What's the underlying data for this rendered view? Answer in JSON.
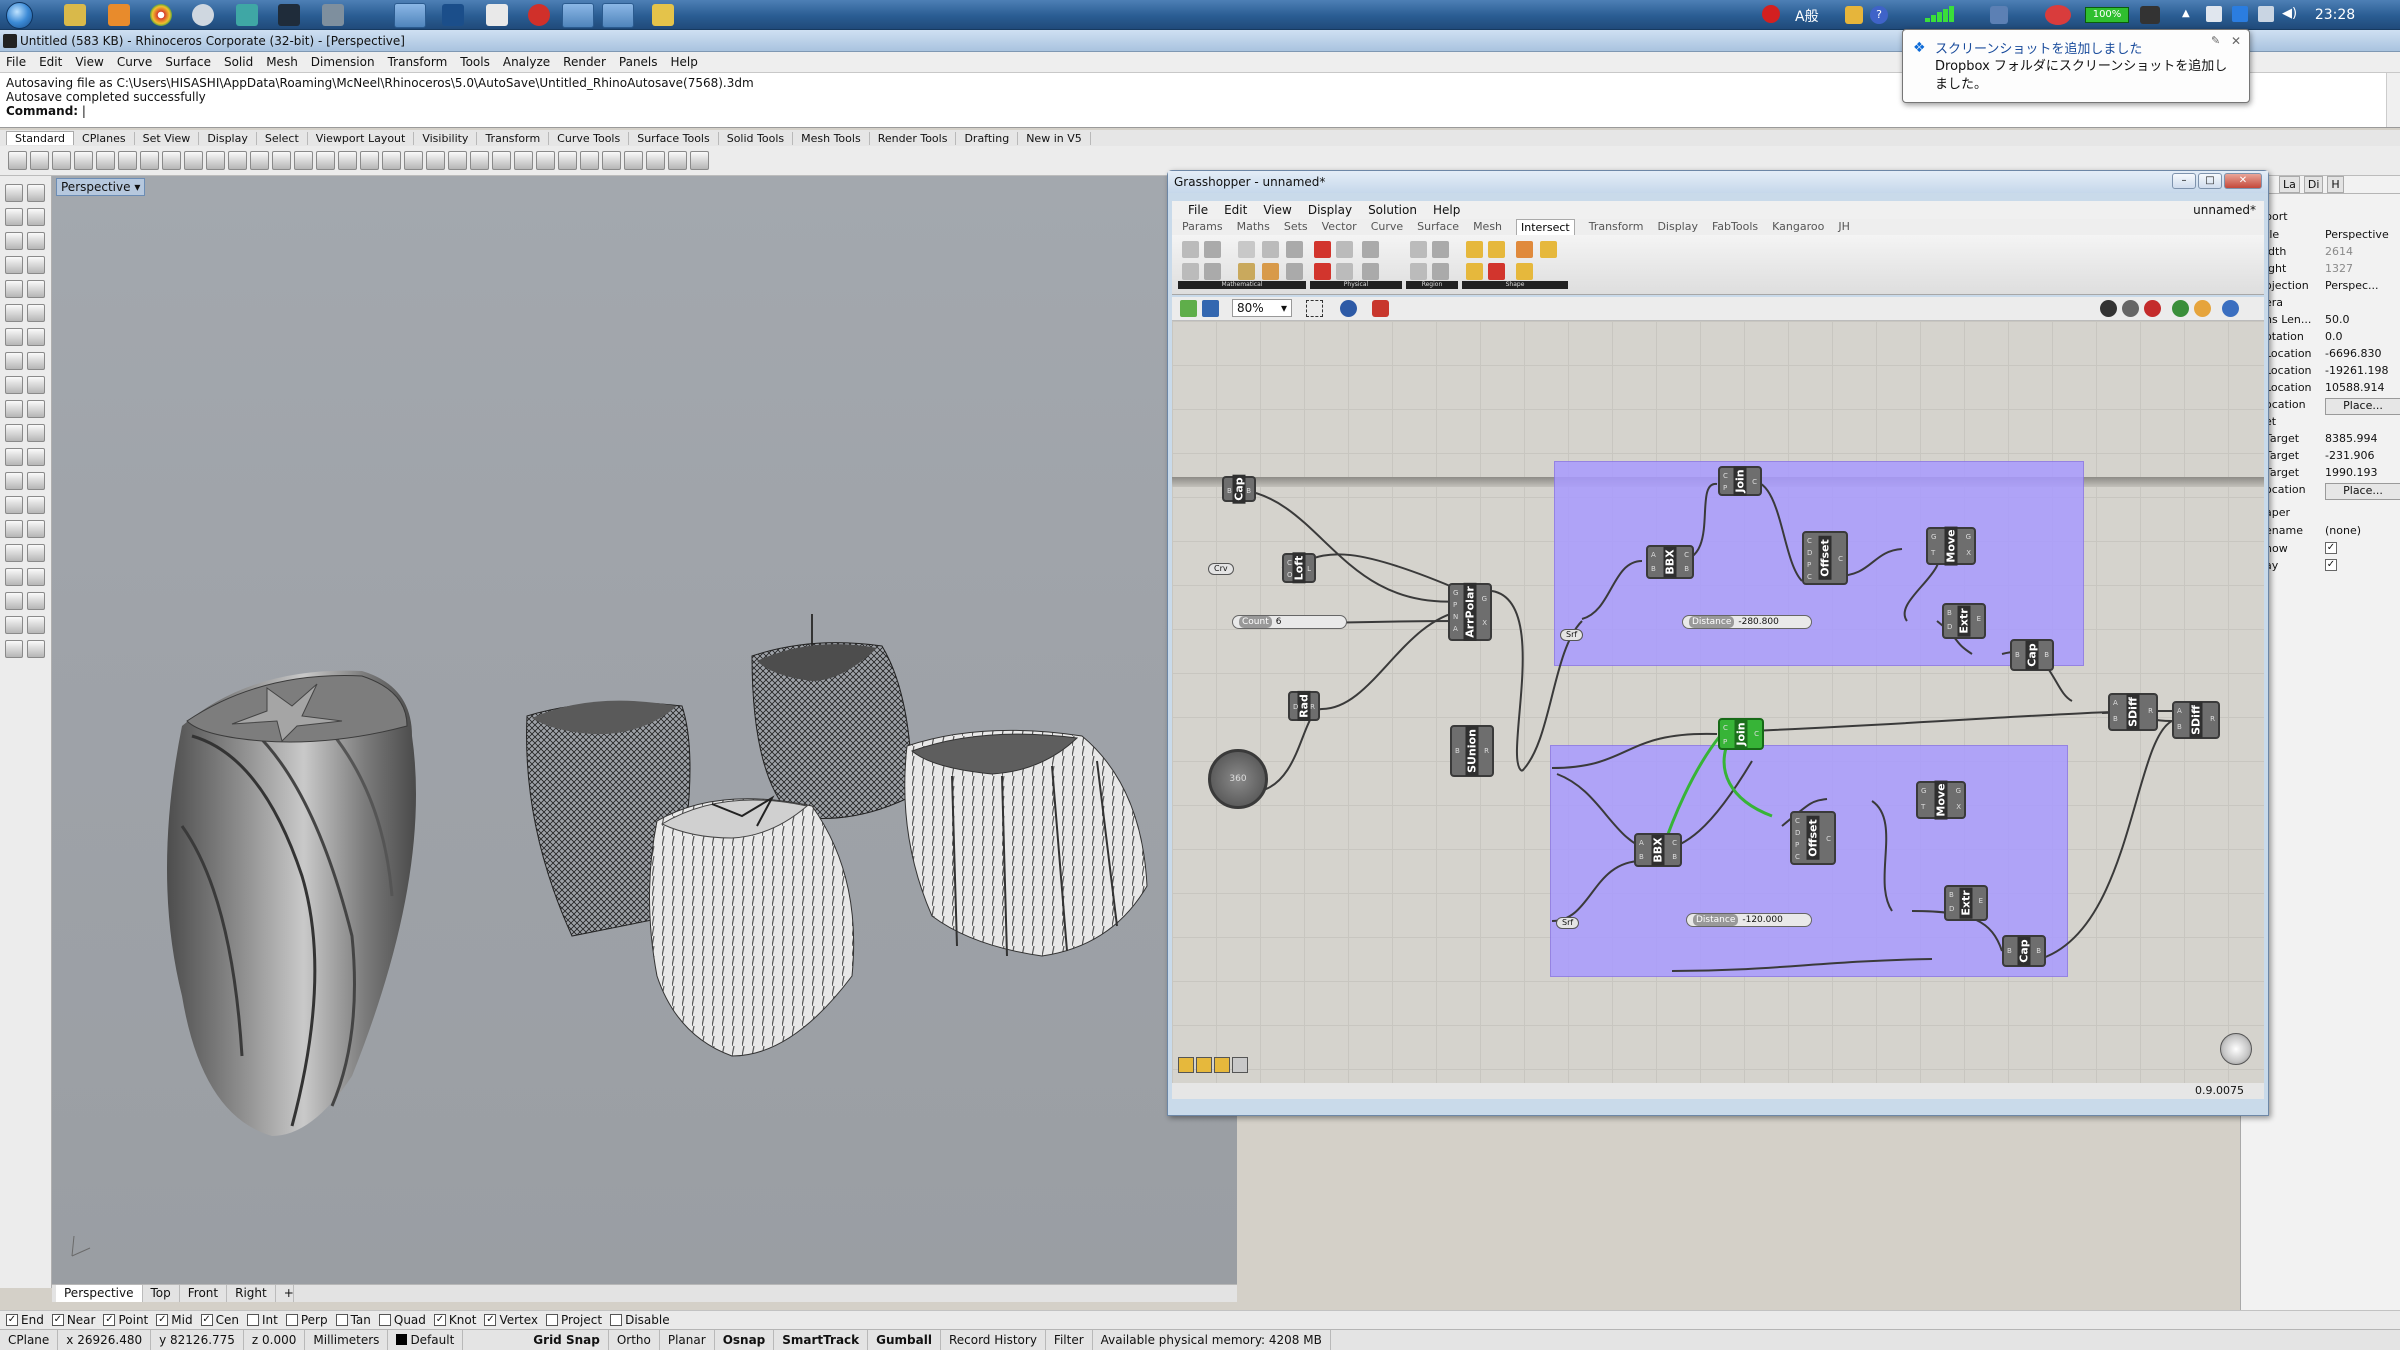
{
  "taskbar": {
    "clock": "23:28",
    "battery": "100%",
    "ime_indicator": "A般"
  },
  "rhino": {
    "title": "Untitled (583 KB) - Rhinoceros Corporate (32-bit) - [Perspective]",
    "menu": [
      "File",
      "Edit",
      "View",
      "Curve",
      "Surface",
      "Solid",
      "Mesh",
      "Dimension",
      "Transform",
      "Tools",
      "Analyze",
      "Render",
      "Panels",
      "Help"
    ],
    "history": [
      "Autosaving file as C:\\Users\\HISASHI\\AppData\\Roaming\\McNeel\\Rhinoceros\\5.0\\AutoSave\\Untitled_RhinoAutosave(7568).3dm",
      "Autosave completed successfully"
    ],
    "command_prompt": "Command:",
    "toolbar_tabs": [
      "Standard",
      "CPlanes",
      "Set View",
      "Display",
      "Select",
      "Viewport Layout",
      "Visibility",
      "Transform",
      "Curve Tools",
      "Surface Tools",
      "Solid Tools",
      "Mesh Tools",
      "Render Tools",
      "Drafting",
      "New in V5"
    ],
    "viewport_label": "Perspective",
    "viewport_tabs": [
      "Perspective",
      "Top",
      "Front",
      "Right"
    ],
    "osnaps": [
      {
        "label": "End",
        "checked": true
      },
      {
        "label": "Near",
        "checked": true
      },
      {
        "label": "Point",
        "checked": true
      },
      {
        "label": "Mid",
        "checked": true
      },
      {
        "label": "Cen",
        "checked": true
      },
      {
        "label": "Int",
        "checked": false
      },
      {
        "label": "Perp",
        "checked": false
      },
      {
        "label": "Tan",
        "checked": false
      },
      {
        "label": "Quad",
        "checked": false
      },
      {
        "label": "Knot",
        "checked": true
      },
      {
        "label": "Vertex",
        "checked": true
      },
      {
        "label": "Project",
        "checked": false
      },
      {
        "label": "Disable",
        "checked": false
      }
    ],
    "status": {
      "cplane": "CPlane",
      "x": "x 26926.480",
      "y": "y 82126.775",
      "z": "z 0.000",
      "units": "Millimeters",
      "layer": "Default",
      "grid_snap": "Grid Snap",
      "ortho": "Ortho",
      "planar": "Planar",
      "osnap": "Osnap",
      "smarttrack": "SmartTrack",
      "gumball": "Gumball",
      "record_history": "Record History",
      "filter": "Filter",
      "memory": "Available physical memory: 4208 MB"
    }
  },
  "properties": {
    "tabs": [
      "La",
      "Di",
      "H"
    ],
    "rows": [
      {
        "k": "port",
        "v": ""
      },
      {
        "k": "tle",
        "v": "Perspective"
      },
      {
        "k": "idth",
        "v": "2614",
        "gray": true
      },
      {
        "k": "ight",
        "v": "1327",
        "gray": true
      },
      {
        "k": "ojection",
        "v": "Perspec..."
      },
      {
        "k": "era",
        "v": ""
      },
      {
        "k": "ns Len...",
        "v": "50.0"
      },
      {
        "k": "otation",
        "v": "0.0"
      },
      {
        "k": "Location",
        "v": "-6696.830"
      },
      {
        "k": "Location",
        "v": "-19261.198"
      },
      {
        "k": "Location",
        "v": "10588.914"
      },
      {
        "k": "ocation",
        "v": "Place...",
        "btn": true
      },
      {
        "k": "et",
        "v": ""
      },
      {
        "k": "Target",
        "v": "8385.994"
      },
      {
        "k": "Target",
        "v": "-231.906"
      },
      {
        "k": "Target",
        "v": "1990.193"
      },
      {
        "k": "ocation",
        "v": "Place...",
        "btn": true
      },
      {
        "k": "aper",
        "v": ""
      },
      {
        "k": "ename",
        "v": "(none)"
      },
      {
        "k": "how",
        "v": "",
        "checkbox": true
      },
      {
        "k": "ay",
        "v": "",
        "checkbox": true
      }
    ]
  },
  "grasshopper": {
    "title": "Grasshopper - unnamed*",
    "menu": [
      "File",
      "Edit",
      "View",
      "Display",
      "Solution",
      "Help"
    ],
    "document": "unnamed*",
    "categories": [
      "Params",
      "Maths",
      "Sets",
      "Vector",
      "Curve",
      "Surface",
      "Mesh",
      "Intersect",
      "Transform",
      "Display",
      "FabTools",
      "Kangaroo",
      "JH"
    ],
    "active_category": "Intersect",
    "groups": [
      "Mathematical",
      "Physical",
      "Region",
      "Shape"
    ],
    "zoom": "80%",
    "version": "0.9.0075",
    "components": {
      "cap1": "Cap",
      "loft": "Loft",
      "crv": "Crv",
      "count": "Count",
      "count_value": "6",
      "rad": "Rad",
      "arrpolar": "ArrPolar",
      "sunion": "SUnion",
      "dial_value": "360",
      "join1": "Join",
      "bbx1": "BBX",
      "offset1": "Offset",
      "move1": "Move",
      "extr1": "Extr",
      "cap2": "Cap",
      "srf1": "Srf",
      "distance1": "Distance",
      "distance1_value": "-280.800",
      "join2": "Join",
      "bbx2": "BBX",
      "offset2": "Offset",
      "move2": "Move",
      "extr2": "Extr",
      "cap3": "Cap",
      "srf2": "Srf",
      "distance2": "Distance",
      "distance2_value": "-120.000",
      "sdiff1": "SDiff",
      "sdiff2": "SDiff"
    }
  },
  "toast": {
    "title": "スクリーンショットを追加しました",
    "body": "Dropbox フォルダにスクリーンショットを追加しました。"
  },
  "colors": {
    "group_fill": "#a99bff",
    "selected_component": "#37b437",
    "viewport_bg": "#a0a4aa"
  }
}
